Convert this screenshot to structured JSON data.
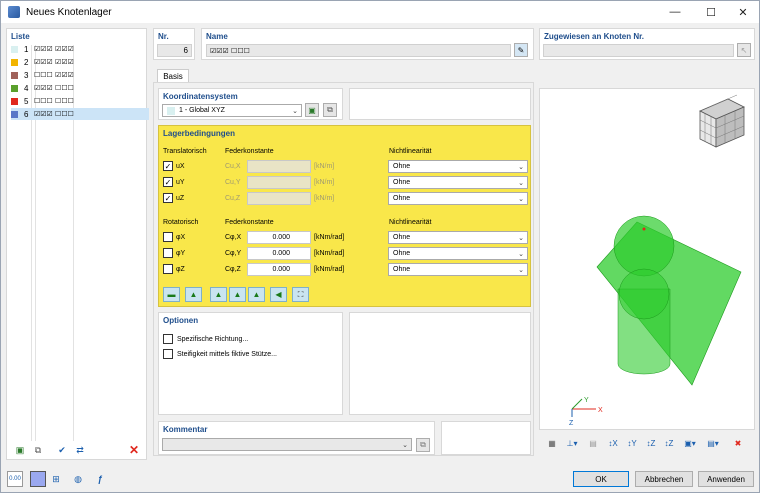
{
  "window": {
    "title": "Neues Knotenlager",
    "minimize": "—",
    "maximize": "☐",
    "close": "✕"
  },
  "list": {
    "title": "Liste",
    "items": [
      {
        "num": "1",
        "color": "#d9f0f0",
        "label": "☑☑☑ ☑☑☑"
      },
      {
        "num": "2",
        "color": "#f2b400",
        "label": "☑☑☑ ☑☑☑"
      },
      {
        "num": "3",
        "color": "#a0625a",
        "label": "☐☐☐ ☑☑☑"
      },
      {
        "num": "4",
        "color": "#5aa02c",
        "label": "☑☑☑ ☐☐☐"
      },
      {
        "num": "5",
        "color": "#e0281e",
        "label": "☐☐☐ ☐☐☐"
      },
      {
        "num": "6",
        "color": "#5a78c8",
        "label": "☑☑☑ ☐☐☐"
      }
    ]
  },
  "header": {
    "nr_label": "Nr.",
    "nr_value": "6",
    "name_label": "Name",
    "name_value": "☑☑☑ ☐☐☐",
    "assigned_label": "Zugewiesen an Knoten Nr.",
    "assigned_value": ""
  },
  "tabs": {
    "basis": "Basis"
  },
  "coord": {
    "label": "Koordinatensystem",
    "value": "1 - Global XYZ"
  },
  "lager": {
    "title": "Lagerbedingungen",
    "trans_label": "Translatorisch",
    "spring_label": "Federkonstante",
    "nonlin_label": "Nichtlinearität",
    "trans": [
      {
        "name": "uX",
        "checked": "✓",
        "spring_name": "Cu,X",
        "value": "",
        "unit": "[kN/m]",
        "nonlin": "Ohne"
      },
      {
        "name": "uY",
        "checked": "✓",
        "spring_name": "Cu,Y",
        "value": "",
        "unit": "[kN/m]",
        "nonlin": "Ohne"
      },
      {
        "name": "uZ",
        "checked": "✓",
        "spring_name": "Cu,Z",
        "value": "",
        "unit": "[kN/m]",
        "nonlin": "Ohne"
      }
    ],
    "rot_label": "Rotatorisch",
    "spring_label2": "Federkonstante",
    "nonlin_label2": "Nichtlinearität",
    "rot": [
      {
        "name": "φX",
        "checked": "",
        "spring_name": "Cφ,X",
        "value": "0.000",
        "unit": "[kNm/rad]",
        "nonlin": "Ohne"
      },
      {
        "name": "φY",
        "checked": "",
        "spring_name": "Cφ,Y",
        "value": "0.000",
        "unit": "[kNm/rad]",
        "nonlin": "Ohne"
      },
      {
        "name": "φZ",
        "checked": "",
        "spring_name": "Cφ,Z",
        "value": "0.000",
        "unit": "[kNm/rad]",
        "nonlin": "Ohne"
      }
    ]
  },
  "options": {
    "title": "Optionen",
    "opt1": "Spezifische Richtung...",
    "opt2": "Steifigkeit mittels fiktive Stütze..."
  },
  "comment": {
    "title": "Kommentar",
    "value": ""
  },
  "axes": {
    "x": "X",
    "y": "Y",
    "z": "Z"
  },
  "buttons": {
    "ok": "OK",
    "cancel": "Abbrechen",
    "apply": "Anwenden"
  },
  "bottom": {
    "units_icon_text": "0.00"
  },
  "colors": {
    "accent_title": "#1f4e8c",
    "yellow_panel": "#f9e74a",
    "support_green": "#2ecc2e",
    "selected_row": "#cce4f7"
  }
}
